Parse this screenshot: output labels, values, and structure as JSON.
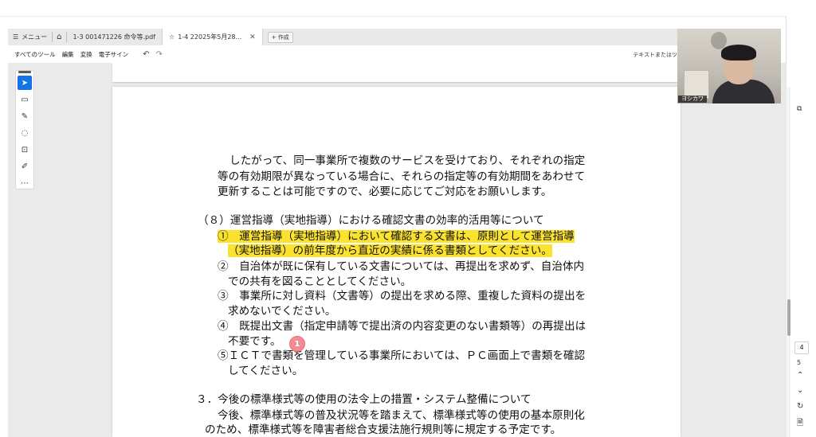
{
  "tabbar": {
    "menu_label": "メニュー",
    "tabs": [
      {
        "label": "1-3  001471226  命令等.pdf",
        "active": false
      },
      {
        "label": "1-4  22025年5月28...",
        "active": true
      }
    ],
    "new_tab_label": "+ 作成"
  },
  "toolbar": {
    "all_tools": "すべてのツール",
    "edit": "編集",
    "convert": "変換",
    "esign": "電子サイン",
    "search_hint": "テキストまたはツ"
  },
  "webcam": {
    "participant_name": "ヨシカワ"
  },
  "document": {
    "lines": [
      "したがって、同一事業所で複数のサービスを受けており、それぞれの指定",
      "等の有効期限が異なっている場合に、それらの指定等の有効期間をあわせて",
      "更新することは可能ですので、必要に応じてご対応をお願いします。",
      "（８）運営指導（実地指導）における確認文書の効率的活用等について",
      "①　運営指導（実地指導）において確認する文書は、原則として運営指導",
      "（実地指導）の前年度から直近の実績に係る書類としてください。",
      "②　自治体が既に保有している文書については、再提出を求めず、自治体内",
      "での共有を図ることとしてください。",
      "③　事業所に対し資料（文書等）の提出を求める際、重複した資料の提出を",
      "求めないでください。",
      "④　既提出文書（指定申請等で提出済の内容変更のない書類等）の再提出は",
      "不要です。",
      "⑤ＩＣＴで書類を管理している事業所においては、ＰＣ画面上で書類を確認",
      "してください。",
      "３．今後の標準様式等の使用の法令上の措置・システム整備について",
      "今後、標準様式等の普及状況等を踏まえて、標準様式等の使用の基本原則化",
      "のため、標準様式等を障害者総合支援法施行規則等に規定する予定です。"
    ],
    "marker_label": "1"
  },
  "navigation": {
    "current_page": "4",
    "next_page": "5"
  },
  "colors": {
    "highlight": "#fbe22f",
    "selected_tool": "#1473e6",
    "marker": "#f38b91"
  }
}
